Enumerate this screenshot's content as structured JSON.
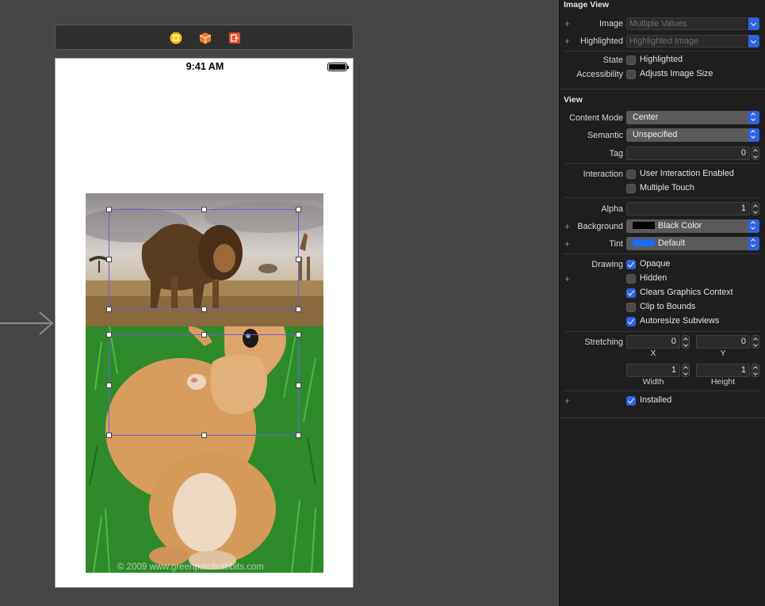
{
  "canvas": {
    "status_time": "9:41 AM",
    "watermark": "© 2009 www.greenpatchrabbits.com",
    "dock_icons": [
      "view-controller-icon",
      "first-responder-icon",
      "exit-icon"
    ],
    "photos": [
      "lion-photo",
      "rabbit-photo"
    ]
  },
  "inspector": {
    "image_view": {
      "title": "Image View",
      "image_label": "Image",
      "image_placeholder": "Multiple Values",
      "highlighted_label": "Highlighted",
      "highlighted_placeholder": "Highlighted Image",
      "state_label": "State",
      "state_checkbox": {
        "label": "Highlighted",
        "checked": false
      },
      "accessibility_label": "Accessibility",
      "accessibility_checkbox": {
        "label": "Adjusts Image Size",
        "checked": false
      }
    },
    "view": {
      "title": "View",
      "content_mode_label": "Content Mode",
      "content_mode_value": "Center",
      "semantic_label": "Semantic",
      "semantic_value": "Unspecified",
      "tag_label": "Tag",
      "tag_value": "0",
      "interaction_label": "Interaction",
      "user_interaction": {
        "label": "User Interaction Enabled",
        "checked": false
      },
      "multiple_touch": {
        "label": "Multiple Touch",
        "checked": false
      },
      "alpha_label": "Alpha",
      "alpha_value": "1",
      "background_label": "Background",
      "background_value": "Black Color",
      "background_color": "#000000",
      "tint_label": "Tint",
      "tint_value": "Default",
      "tint_color": "#1a6cf0",
      "drawing_label": "Drawing",
      "opaque": {
        "label": "Opaque",
        "checked": true
      },
      "hidden": {
        "label": "Hidden",
        "checked": false
      },
      "clears_graphics": {
        "label": "Clears Graphics Context",
        "checked": true
      },
      "clip_to_bounds": {
        "label": "Clip to Bounds",
        "checked": false
      },
      "autoresize": {
        "label": "Autoresize Subviews",
        "checked": true
      },
      "stretching_label": "Stretching",
      "stretch_x": "0",
      "stretch_y": "0",
      "stretch_width": "1",
      "stretch_height": "1",
      "x_label": "X",
      "y_label": "Y",
      "width_label": "Width",
      "height_label": "Height",
      "installed": {
        "label": "Installed",
        "checked": true
      }
    }
  },
  "colors": {
    "accent": "#2f63e0",
    "selection": "#6a5fd8",
    "inspector_bg": "#1e1e1e",
    "canvas_bg": "#464646"
  }
}
